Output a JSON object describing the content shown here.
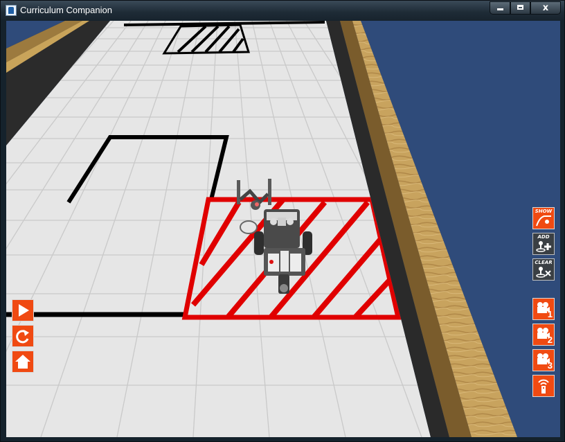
{
  "window": {
    "title": "Curriculum Companion",
    "close_glyph": "x"
  },
  "scene": {
    "colors": {
      "background": "#2f4b7a",
      "mat": "#e9e9e9",
      "lines": "#000000",
      "target_zone": "#e00000",
      "rail": "#c9a45a"
    },
    "objects": [
      "mat",
      "start-zone-hatched",
      "target-zone-red-hatched",
      "black-outline-square",
      "robot",
      "wooden-rail"
    ]
  },
  "left_controls": [
    {
      "id": "play",
      "icon": "play-icon"
    },
    {
      "id": "reset",
      "icon": "reset-icon"
    },
    {
      "id": "home",
      "icon": "home-icon"
    }
  ],
  "right_controls": {
    "show": {
      "label": "SHOW",
      "icon": "show-path-icon"
    },
    "add": {
      "label": "ADD",
      "icon": "add-marker-icon"
    },
    "clear": {
      "label": "CLEAR",
      "icon": "clear-marker-icon"
    },
    "cameras": [
      {
        "label": "1",
        "icon": "camera-icon"
      },
      {
        "label": "2",
        "icon": "camera-icon"
      },
      {
        "label": "3",
        "icon": "camera-icon"
      }
    ],
    "remote": {
      "icon": "remote-control-icon"
    }
  }
}
